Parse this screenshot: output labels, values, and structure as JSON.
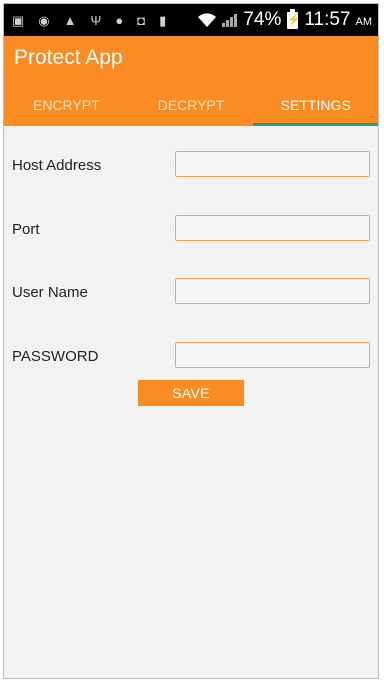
{
  "status_bar": {
    "left_icons": [
      "image-icon",
      "wifi-hotspot-icon",
      "warning-icon",
      "usb-icon",
      "lock-icon",
      "gallery-icon",
      "barcode-icon"
    ],
    "battery_percent": "74%",
    "time": "11:57",
    "ampm": "AM"
  },
  "app": {
    "title": "Protect App",
    "accent_color": "#fb8c23",
    "tab_indicator_color": "#1ba18c"
  },
  "tabs": [
    {
      "label": "ENCRYPT",
      "active": false
    },
    {
      "label": "DECRYPT",
      "active": false
    },
    {
      "label": "SETTINGS",
      "active": true
    }
  ],
  "form": {
    "host": {
      "label": "Host Address",
      "value": ""
    },
    "port": {
      "label": "Port",
      "value": ""
    },
    "username": {
      "label": "User Name",
      "value": ""
    },
    "password": {
      "label": "PASSWORD",
      "value": ""
    },
    "save_label": "SAVE"
  }
}
